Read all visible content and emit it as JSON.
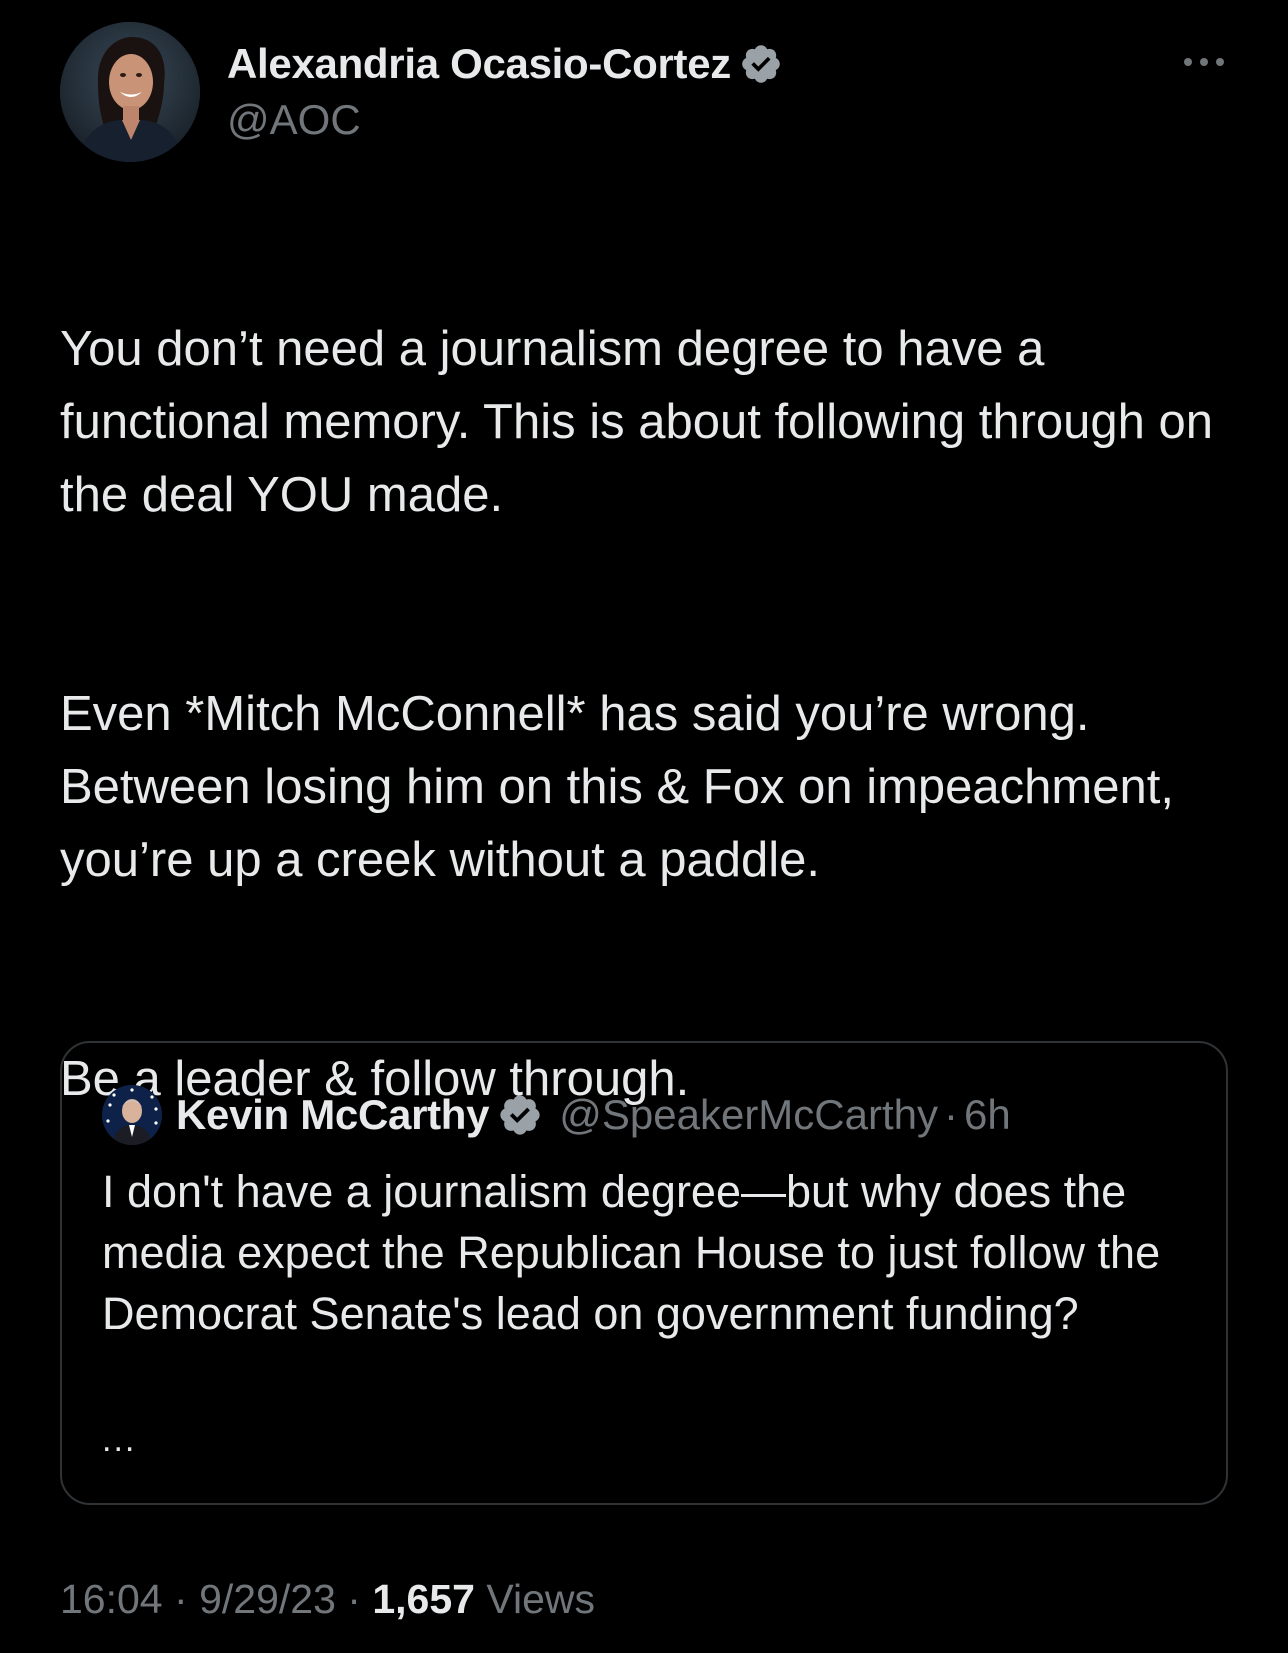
{
  "author": {
    "name": "Alexandria Ocasio-Cortez",
    "handle": "@AOC",
    "verified": true
  },
  "tweet": {
    "paragraphs": [
      "You don’t need a journalism degree to have a functional memory. This is about following through on the deal YOU made.",
      "Even *Mitch McConnell* has said you’re wrong. Between losing him on this & Fox on impeachment, you’re up a creek without a paddle.",
      "Be a leader & follow through."
    ]
  },
  "quote": {
    "name": "Kevin McCarthy",
    "handle": "@SpeakerMcCarthy",
    "separator": "·",
    "time": "6h",
    "verified": true,
    "text": "I don't have a journalism degree—but why does the media expect the Republican House to just follow the Democrat Senate's lead on government funding?",
    "ellipsis": "..."
  },
  "meta": {
    "time": "16:04",
    "separator": "·",
    "date": "9/29/23",
    "views_count": "1,657",
    "views_label": "Views"
  },
  "icons": {
    "more": "more-horizontal-icon",
    "verified": "verified-badge-icon"
  },
  "colors": {
    "background": "#000000",
    "primary_text": "#e7e9ea",
    "secondary_text": "#71767b",
    "border": "#2f3336",
    "verified_badge": "#9aa1a7"
  }
}
